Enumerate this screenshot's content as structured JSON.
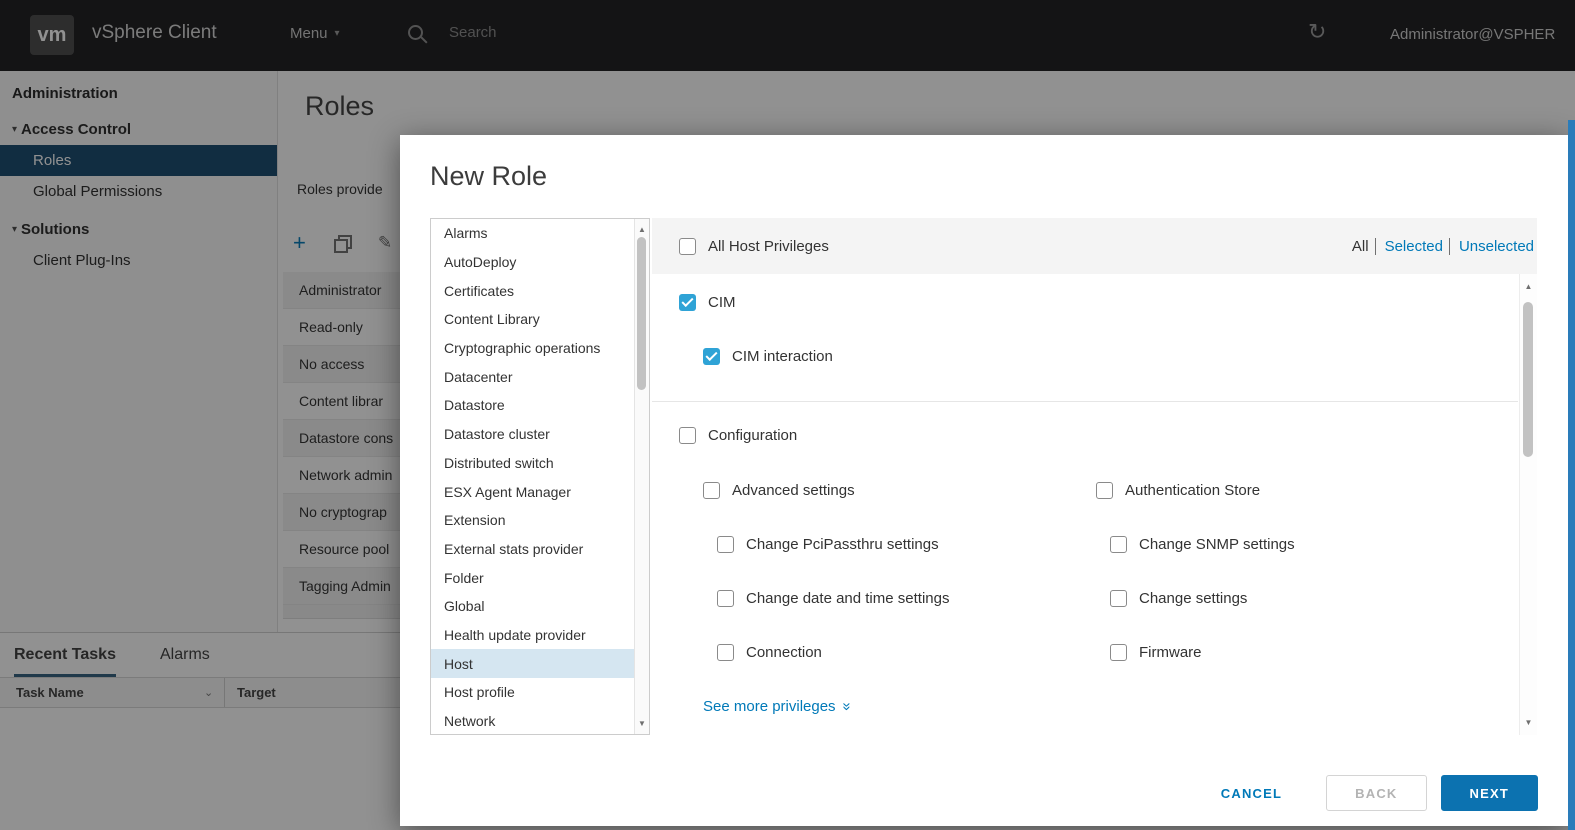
{
  "colors": {
    "accent": "#0079b8",
    "selected_nav": "#17496e",
    "checkbox_checked": "#2fa3d6"
  },
  "icons": {
    "caret_down": "▾",
    "refresh": "↻",
    "plus": "+",
    "edit": "✎",
    "scroll_up": "▲",
    "scroll_down": "▼",
    "chevron_double": "»",
    "column_caret": "⌄"
  },
  "topbar": {
    "logo": "vm",
    "app_title": "vSphere Client",
    "menu": "Menu",
    "search_placeholder": "Search",
    "user": "Administrator@VSPHER"
  },
  "sidebar": {
    "title": "Administration",
    "items": [
      {
        "label": "Access Control"
      },
      {
        "label": "Roles"
      },
      {
        "label": "Global Permissions"
      },
      {
        "label": "Solutions"
      },
      {
        "label": "Client Plug-Ins"
      }
    ]
  },
  "main": {
    "page_title": "Roles",
    "provider_label": "Roles provide",
    "roles": [
      "Administrator",
      "Read-only",
      "No access",
      "Content librar",
      "Datastore cons",
      "Network admin",
      "No cryptograp",
      "Resource pool",
      "Tagging Admin"
    ]
  },
  "tasks": {
    "tabs": [
      {
        "label": "Recent Tasks"
      },
      {
        "label": "Alarms"
      }
    ],
    "columns": [
      {
        "label": "Task Name"
      },
      {
        "label": "Target"
      }
    ]
  },
  "modal": {
    "title": "New Role",
    "categories": [
      "Alarms",
      "AutoDeploy",
      "Certificates",
      "Content Library",
      "Cryptographic operations",
      "Datacenter",
      "Datastore",
      "Datastore cluster",
      "Distributed switch",
      "ESX Agent Manager",
      "Extension",
      "External stats provider",
      "Folder",
      "Global",
      "Health update provider",
      "Host",
      "Host profile",
      "Network"
    ],
    "selected_category": "Host",
    "header": {
      "label": "All Host Privileges",
      "filters": [
        {
          "label": "All"
        },
        {
          "label": "Selected"
        },
        {
          "label": "Unselected"
        }
      ]
    },
    "privileges": [
      {
        "label": "CIM",
        "checked": true
      },
      {
        "label": "CIM interaction",
        "checked": true
      }
    ],
    "configuration": {
      "label": "Configuration",
      "checked": false
    },
    "config_items": [
      {
        "label": "Advanced settings"
      },
      {
        "label": "Authentication Store"
      },
      {
        "label": "Change PciPassthru settings"
      },
      {
        "label": "Change SNMP settings"
      },
      {
        "label": "Change date and time settings"
      },
      {
        "label": "Change settings"
      },
      {
        "label": "Connection"
      },
      {
        "label": "Firmware"
      }
    ],
    "see_more": "See more privileges",
    "footer": {
      "cancel": "CANCEL",
      "back": "BACK",
      "next": "NEXT"
    }
  }
}
